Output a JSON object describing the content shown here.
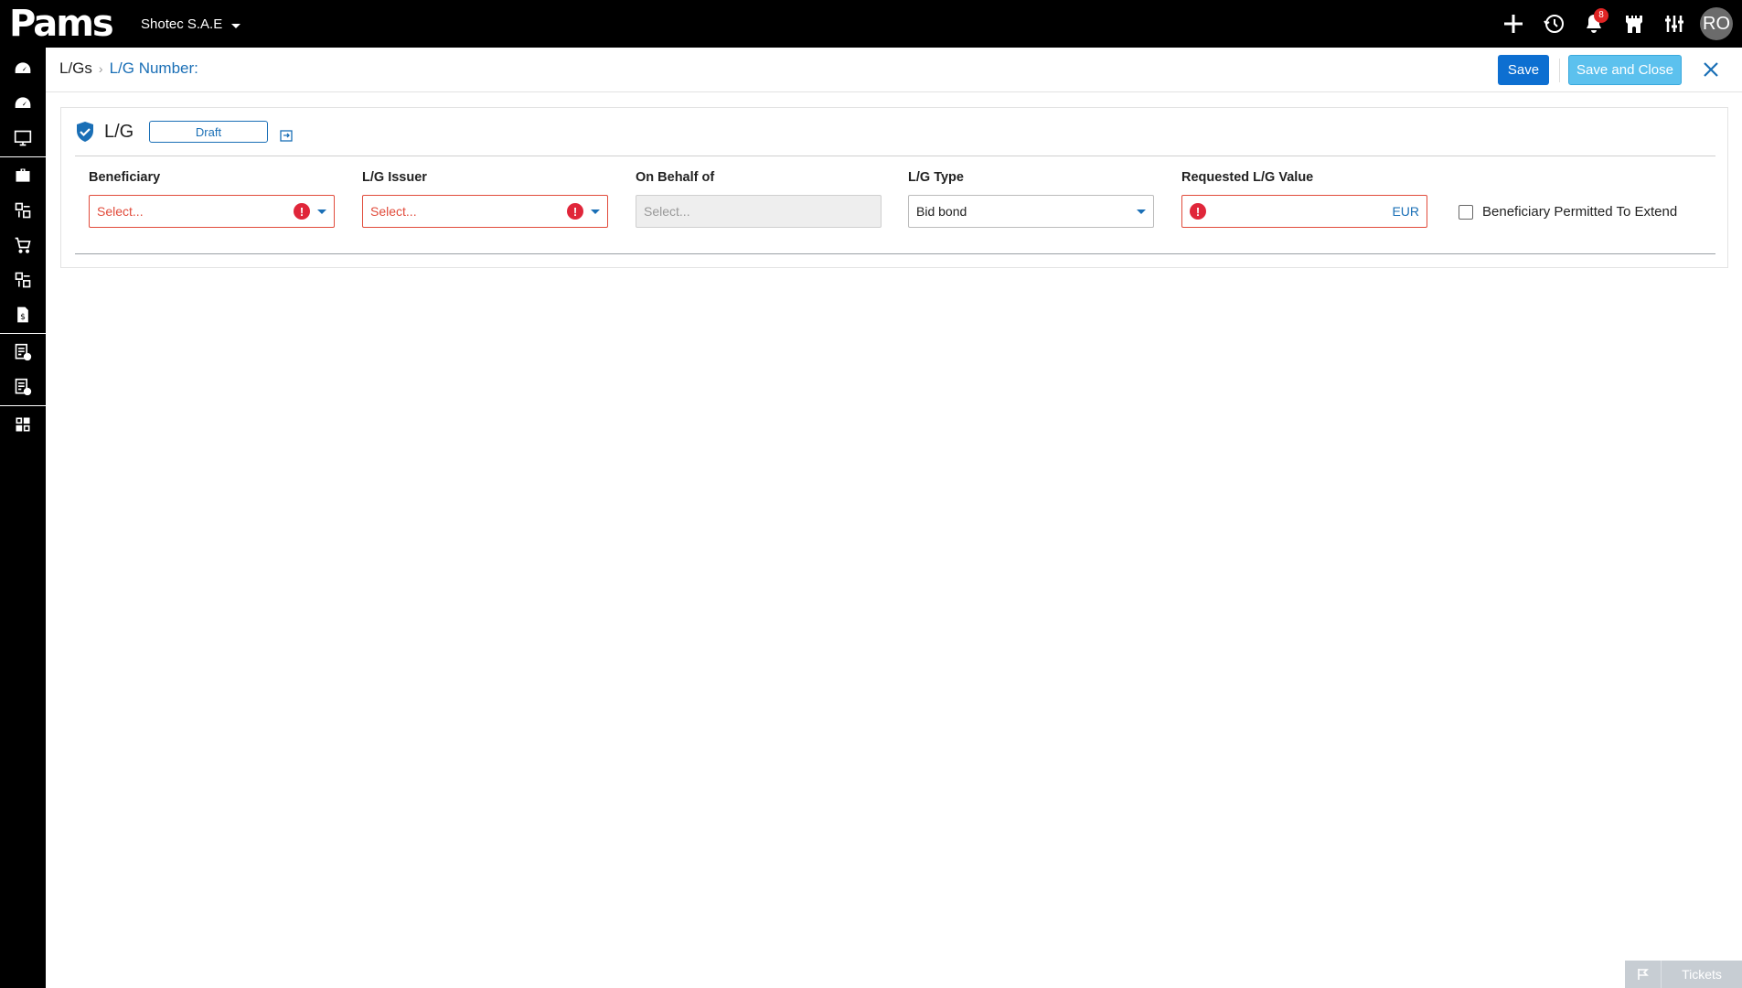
{
  "app": {
    "logo_text": "Pams",
    "company": "Shotec S.A.E",
    "notifications_count": "8",
    "user_initials": "RO"
  },
  "top_icons": [
    "add-icon",
    "history-clock-icon",
    "bell-icon",
    "castle-icon",
    "sliders-icon"
  ],
  "sidebar": {
    "items": [
      "dashboard-gauge-icon",
      "dashboard-gauge-icon-2",
      "monitor-icon",
      "briefcase-icon",
      "modules-icon",
      "cart-icon",
      "modules-icon-2",
      "money-document-icon",
      "checklist-approved-icon",
      "checklist-rejected-icon",
      "grid-layout-icon"
    ]
  },
  "header": {
    "breadcrumb_root": "L/Gs",
    "breadcrumb_current": "L/G Number:",
    "save_label": "Save",
    "save_close_label": "Save and Close"
  },
  "card": {
    "title": "L/G",
    "status": "Draft",
    "fields": {
      "beneficiary": {
        "label": "Beneficiary",
        "placeholder": "Select..."
      },
      "issuer": {
        "label": "L/G Issuer",
        "placeholder": "Select..."
      },
      "on_behalf": {
        "label": "On Behalf of",
        "placeholder": "Select..."
      },
      "type": {
        "label": "L/G Type",
        "value": "Bid bond"
      },
      "value": {
        "label": "Requested L/G Value",
        "currency": "EUR"
      }
    },
    "checkbox_label": "Beneficiary Permitted To Extend"
  },
  "tickets_label": "Tickets",
  "colors": {
    "primary": "#0d6fd1",
    "secondary_button": "#5cc1ee",
    "error": "#e14b3b",
    "link": "#1a6fb6"
  }
}
